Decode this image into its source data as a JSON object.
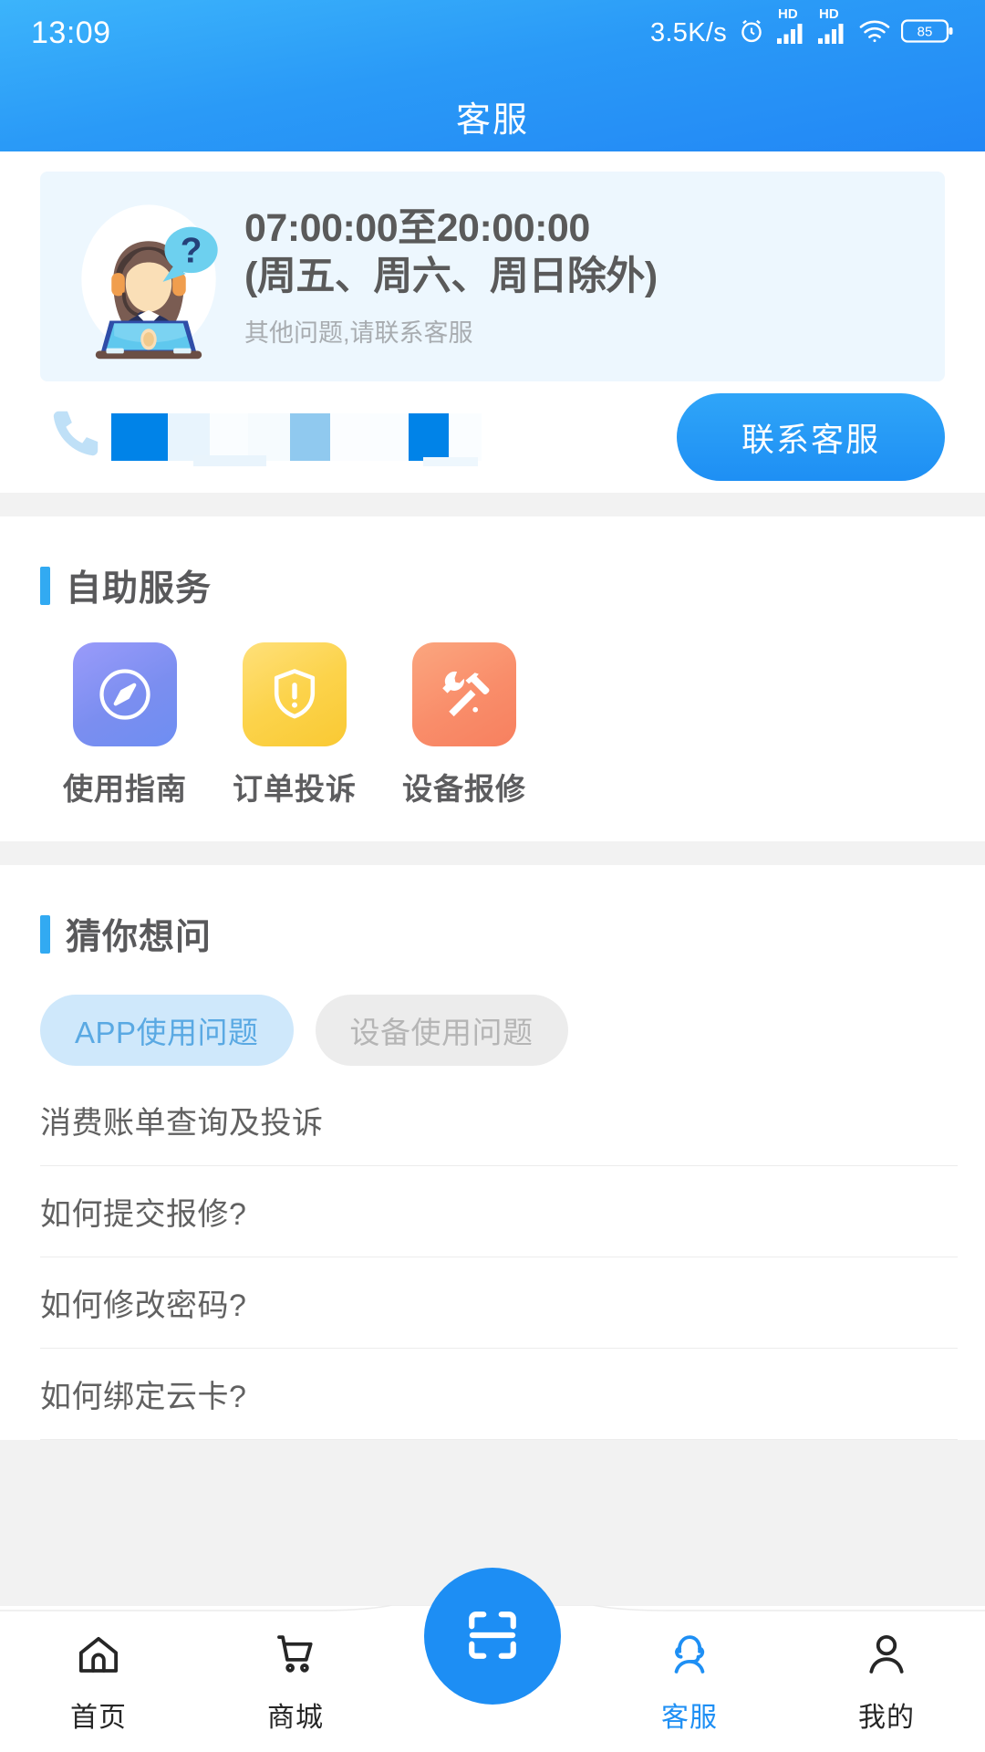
{
  "status_bar": {
    "time": "13:09",
    "network_speed": "3.5K/s",
    "battery_level": "85",
    "hd_label_1": "HD",
    "hd_label_2": "HD"
  },
  "app_bar": {
    "title": "客服"
  },
  "service_card": {
    "hours_line_1": "07:00:00至20:00:00",
    "hours_line_2": "(周五、周六、周日除外)",
    "subtitle": "其他问题,请联系客服",
    "illustration": "customer-service-agent-illustration"
  },
  "contact": {
    "phone_masked": "",
    "button_label": "联系客服"
  },
  "self_service": {
    "section_title": "自助服务",
    "items": [
      {
        "label": "使用指南",
        "icon": "compass-icon",
        "color": "#7b8ef0"
      },
      {
        "label": "订单投诉",
        "icon": "shield-alert-icon",
        "color": "#fcd34b"
      },
      {
        "label": "设备报修",
        "icon": "wrench-hammer-icon",
        "color": "#f98d6a"
      }
    ]
  },
  "faq": {
    "section_title": "猜你想问",
    "tabs": [
      {
        "label": "APP使用问题",
        "active": true
      },
      {
        "label": "设备使用问题",
        "active": false
      }
    ],
    "questions": [
      "消费账单查询及投诉",
      "如何提交报修?",
      "如何修改密码?",
      "如何绑定云卡?"
    ]
  },
  "tabbar": {
    "items": [
      {
        "label": "首页",
        "icon": "home-icon",
        "active": false
      },
      {
        "label": "商城",
        "icon": "cart-icon",
        "active": false
      },
      {
        "label": "客服",
        "icon": "headset-person-icon",
        "active": true
      },
      {
        "label": "我的",
        "icon": "user-icon",
        "active": false
      }
    ],
    "scan_button": "scan-qr-icon"
  },
  "colors": {
    "brand_blue": "#1e8ff4",
    "accent_bar": "#32aaf2",
    "card_bg": "#edf7fe",
    "chip_active_bg": "#cfe8fb",
    "chip_active_text": "#5aa9e3"
  }
}
